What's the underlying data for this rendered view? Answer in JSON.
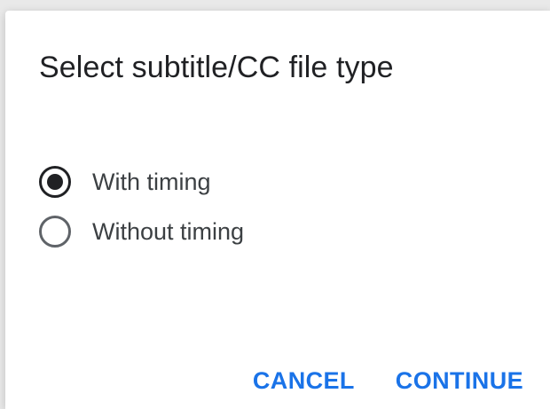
{
  "dialog": {
    "title": "Select subtitle/CC file type",
    "options": [
      {
        "label": "With timing",
        "selected": true
      },
      {
        "label": "Without timing",
        "selected": false
      }
    ],
    "actions": {
      "cancel_label": "CANCEL",
      "continue_label": "CONTINUE"
    }
  },
  "colors": {
    "accent": "#1a73e8",
    "text": "#202124",
    "background": "#ffffff"
  }
}
